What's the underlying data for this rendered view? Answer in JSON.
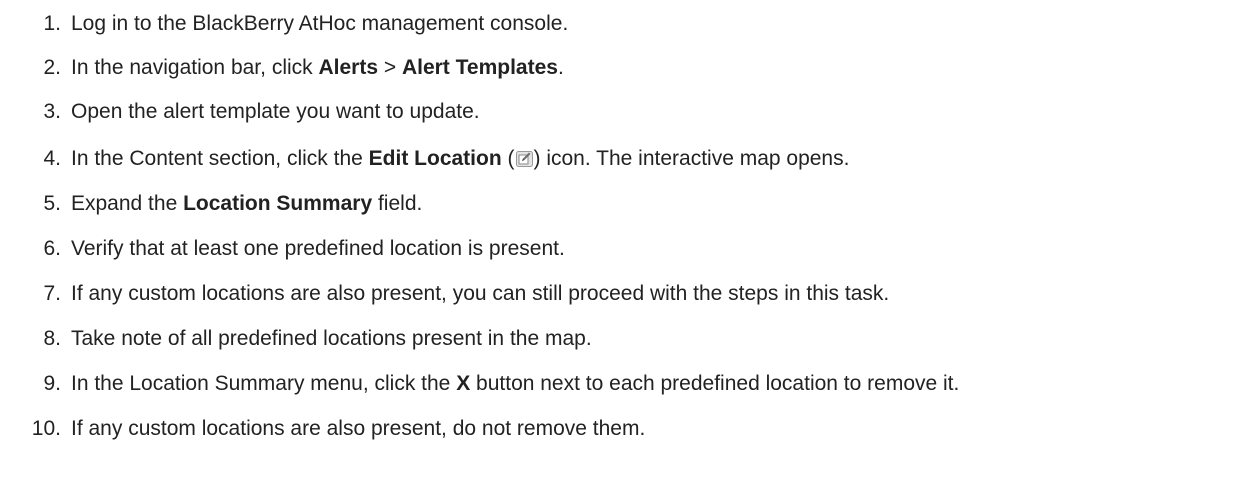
{
  "steps": [
    {
      "number": "1.",
      "text": "Log in to the BlackBerry AtHoc management console."
    },
    {
      "number": "2.",
      "pre": "In the navigation bar, click ",
      "bold1": "Alerts",
      "mid": " > ",
      "bold2": "Alert Templates",
      "post": "."
    },
    {
      "number": "3.",
      "text": "Open the alert template you want to update."
    },
    {
      "number": "4.",
      "pre": "In the Content section, click the ",
      "bold": "Edit Location",
      "paren_open": " (",
      "icon": "edit-pencil-icon",
      "post": ") icon. The interactive map opens."
    },
    {
      "number": "5.",
      "pre": "Expand the ",
      "bold": "Location Summary",
      "post": " field."
    },
    {
      "number": "6.",
      "text": "Verify that at least one predefined location is present."
    },
    {
      "number": "7.",
      "text": "If any custom locations are also present, you can still proceed with the steps in this task."
    },
    {
      "number": "8.",
      "text": "Take note of all predefined locations present in the map."
    },
    {
      "number": "9.",
      "pre": "In the Location Summary menu, click the ",
      "bold": "X",
      "post": " button next to each predefined location to remove it."
    },
    {
      "number": "10.",
      "text": "If any custom locations are also present, do not remove them."
    }
  ],
  "colors": {
    "text": "#222222",
    "icon_border": "#9a9a9a",
    "icon_fill": "#e4e4e4"
  }
}
